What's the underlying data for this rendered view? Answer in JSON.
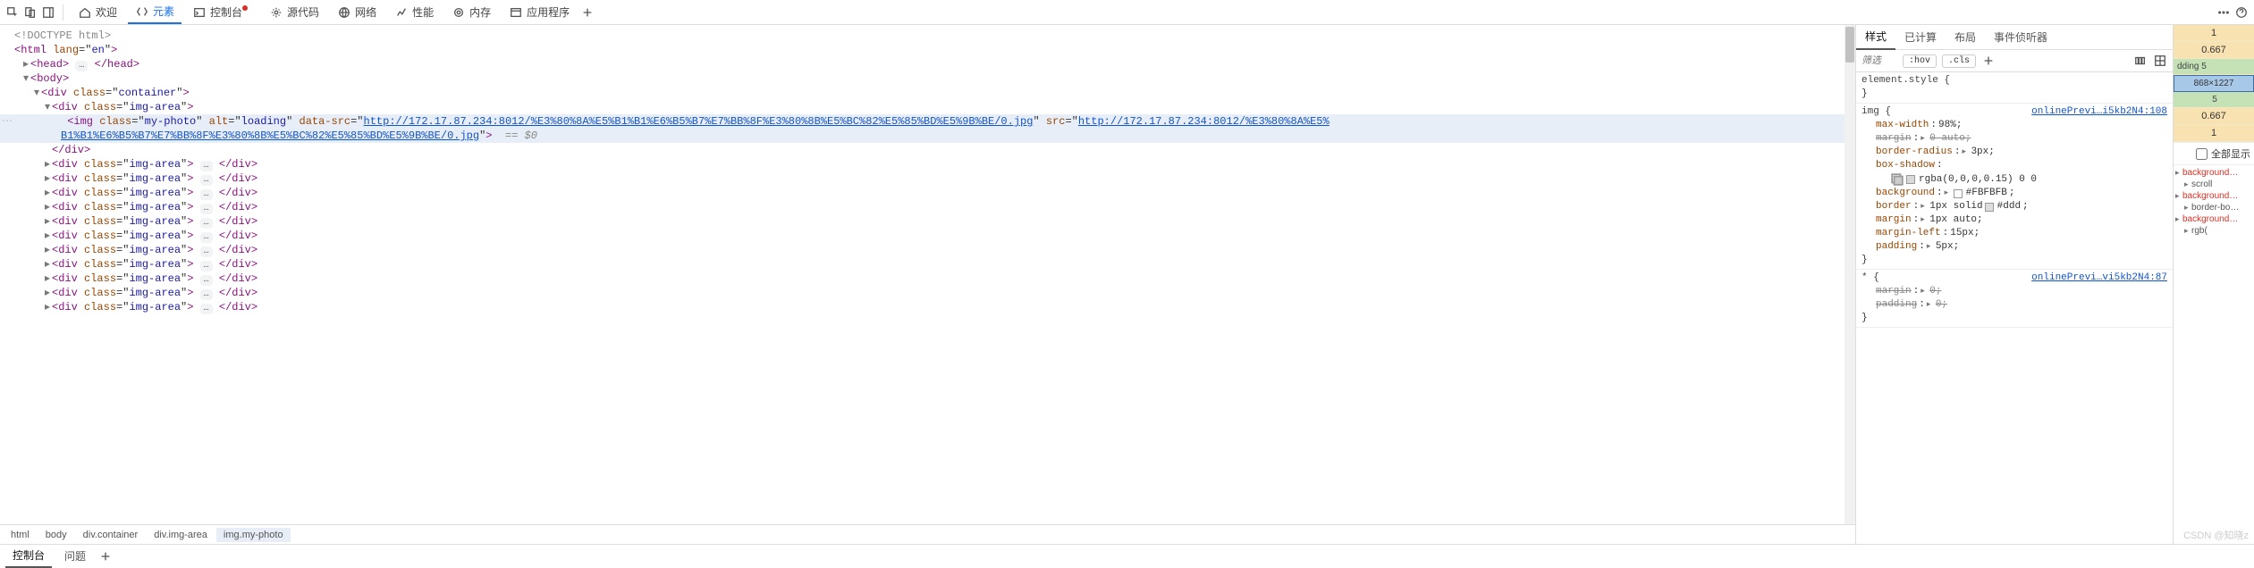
{
  "toolbar": {
    "tabs": {
      "welcome": "欢迎",
      "elements": "元素",
      "console": "控制台",
      "sources": "源代码",
      "network": "网络",
      "performance": "性能",
      "memory": "内存",
      "application": "应用程序"
    }
  },
  "dom": {
    "doctype": "<!DOCTYPE html>",
    "html_open": "<html lang=\"en\">",
    "head_open": "<head>",
    "head_close": "</head>",
    "body_open": "<body>",
    "container_open": "<div class=\"container\">",
    "imgarea_open": "<div class=\"img-area\">",
    "img_line_p1_tag": "<img",
    "img_line_attr_class": "class",
    "img_line_val_class": "my-photo",
    "img_line_attr_alt": "alt",
    "img_line_val_alt": "loading",
    "img_line_attr_datasrc": "data-src",
    "img_line_val_datasrc": "http://172.17.87.234:8012/%E3%80%8A%E5%B1%B1%E6%B5%B7%E7%BB%8F%E3%80%8B%E5%BC%82%E5%85%BD%E5%9B%BE/0.jpg",
    "img_line_attr_src": "src",
    "img_line_val_src": "http://172.17.87.234:8012/%E3%80%8A%E5%B1%B1%E6%B5%B7%E7%BB%8F%E3%80%8B%E5%BC%82%E5%85%BD%E5%9B%BE/0.jpg",
    "img_line_wrap": "B1%B1%E6%B5%B7%E7%BB%8F%E3%80%8B%E5%BC%82%E5%85%BD%E5%9B%BE/0.jpg",
    "sel_after": "== $0",
    "close_div": "</div>",
    "repeat_open": "<div class=\"img-area\">",
    "repeat_close": "</div>",
    "ellipsis": "…"
  },
  "breadcrumb": {
    "c1": "html",
    "c2": "body",
    "c3": "div.container",
    "c4": "div.img-area",
    "c5": "img.my-photo"
  },
  "styles": {
    "tabs": {
      "styles": "样式",
      "computed": "已计算",
      "layout": "布局",
      "listeners": "事件侦听器"
    },
    "filter_placeholder": "筛选",
    "hov": ":hov",
    "cls": ".cls",
    "element_style_sel": "element.style",
    "rule_img_sel": "img",
    "rule_img_src": "onlinePrevi…i5kb2N4:108",
    "p_maxwidth_name": "max-width",
    "p_maxwidth_val": "98%;",
    "p_margin_name": "margin",
    "p_margin_val": "0 auto;",
    "p_borderradius_name": "border-radius",
    "p_borderradius_val": "3px;",
    "p_boxshadow_name": "box-shadow",
    "p_boxshadow_val": "rgba(0,0,0,0.15) 0 0",
    "p_background_name": "background",
    "p_background_color": "#FBFBFB",
    "p_border_name": "border",
    "p_border_val": "1px solid",
    "p_border_color": "#ddd",
    "p_margin2_name": "margin",
    "p_margin2_val": "1px auto;",
    "p_marginleft_name": "margin-left",
    "p_marginleft_val": "15px;",
    "p_padding_name": "padding",
    "p_padding_val": "5px;",
    "rule_star_sel": "*",
    "rule_star_src": "onlinePrevi…vi5kb2N4:87",
    "p_margin3_name": "margin",
    "p_margin3_val": "0;",
    "p_padding2_name": "padding",
    "p_padding2_val": "0;"
  },
  "metrics": {
    "m1": "1",
    "m2": "0.667",
    "padding_lbl": "dding 5",
    "dim": "868×1227",
    "m3": "5",
    "m4": "0.667",
    "m5": "1",
    "showall": "全部显示",
    "l1": "background…",
    "l1s": "scroll",
    "l2": "background…",
    "l2s": "border-bo…",
    "l3": "background…",
    "l3s": "rgb("
  },
  "bottom": {
    "console": "控制台",
    "issues": "问题"
  },
  "watermark": "CSDN @知晓z"
}
